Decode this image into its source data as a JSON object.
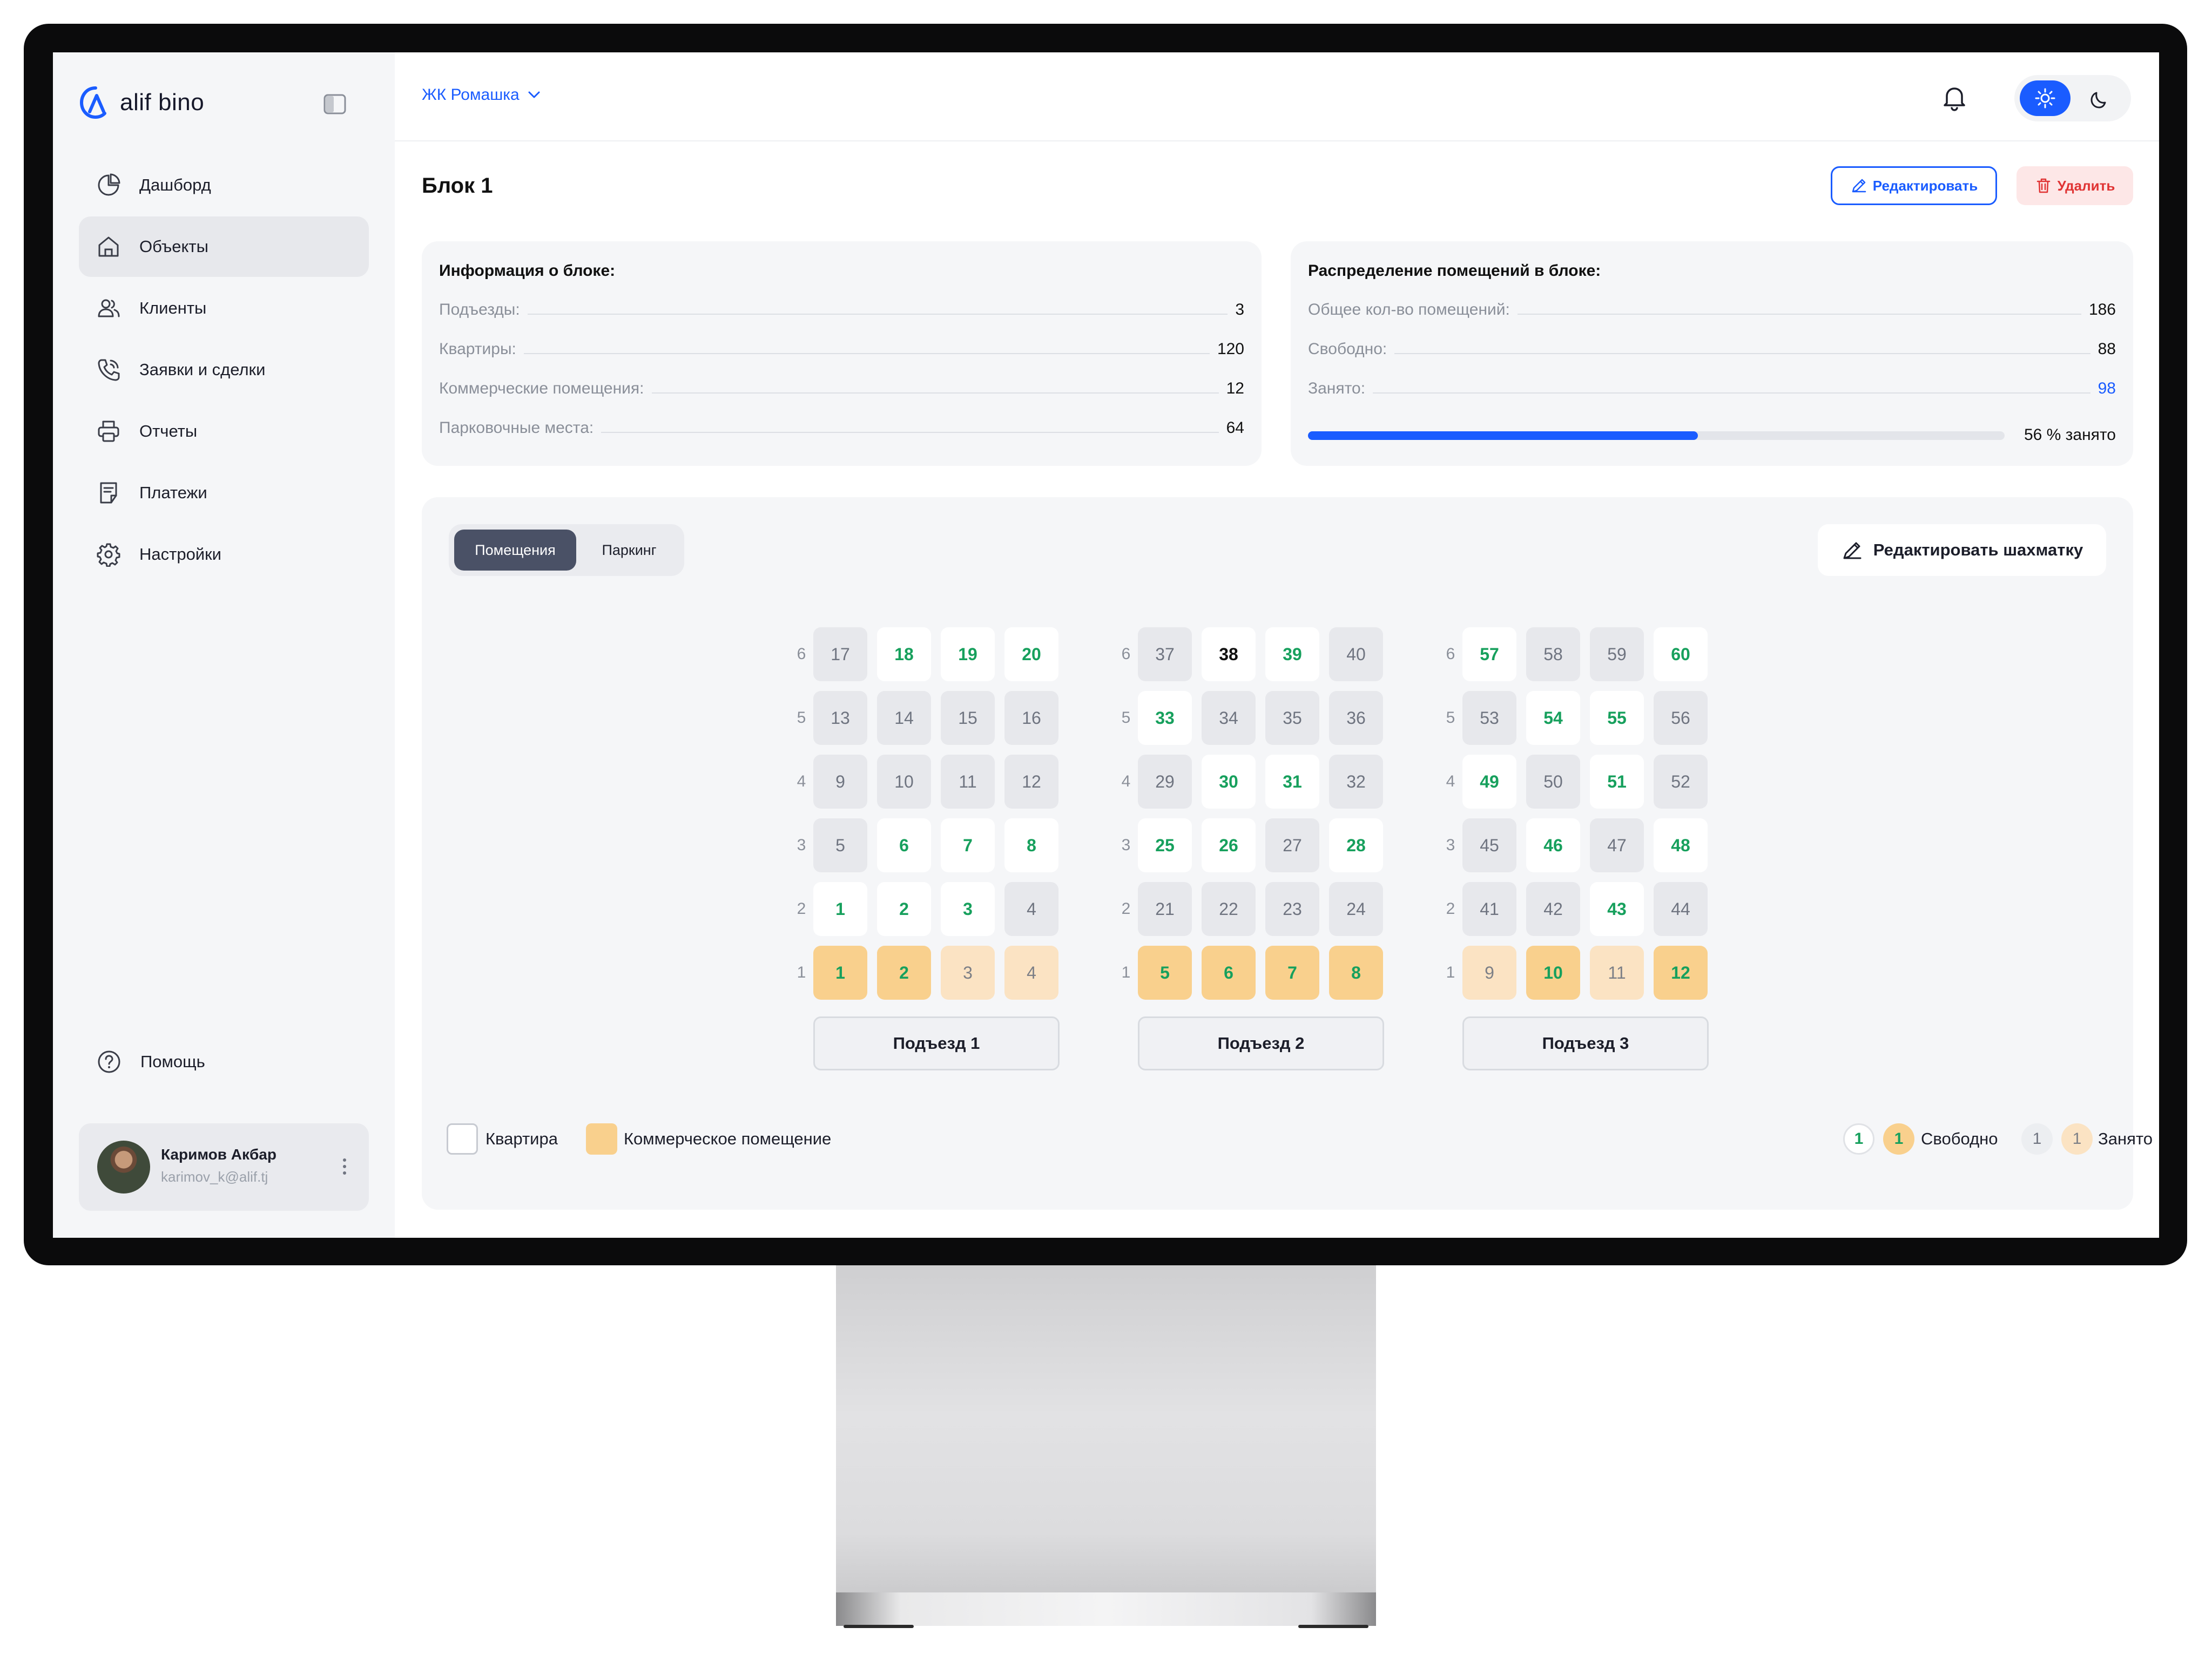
{
  "sidebar": {
    "logo": "alif bino",
    "items": [
      {
        "label": "Дашборд"
      },
      {
        "label": "Объекты"
      },
      {
        "label": "Клиенты"
      },
      {
        "label": "Заявки и сделки"
      },
      {
        "label": "Отчеты"
      },
      {
        "label": "Платежи"
      },
      {
        "label": "Настройки"
      }
    ],
    "help": "Помощь",
    "user": {
      "name": "Каримов Акбар",
      "email": "karimov_k@alif.tj"
    }
  },
  "header": {
    "complex": "ЖК Ромашка"
  },
  "page": {
    "title": "Блок 1",
    "edit": "Редактировать",
    "delete": "Удалить"
  },
  "info": {
    "title": "Информация о блоке:",
    "rows": [
      {
        "label": "Подъезды:",
        "value": "3"
      },
      {
        "label": "Квартиры:",
        "value": "120"
      },
      {
        "label": "Коммерческие помещения:",
        "value": "12"
      },
      {
        "label": "Парковочные места:",
        "value": "64"
      }
    ]
  },
  "distribution": {
    "title": "Распределение помещений в блоке:",
    "rows": [
      {
        "label": "Общее кол-во помещений:",
        "value": "186"
      },
      {
        "label": "Свободно:",
        "value": "88"
      },
      {
        "label": "Занято:",
        "value": "98"
      }
    ],
    "occupied_percent": 56,
    "progress_label": "56 % занято"
  },
  "chess": {
    "tabs": [
      "Помещения",
      "Паркинг"
    ],
    "edit_button": "Редактировать шахматку",
    "floors": [
      "6",
      "5",
      "4",
      "3",
      "2",
      "1"
    ],
    "entrances": [
      {
        "name": "Подъезд 1",
        "rows": [
          [
            {
              "n": "17",
              "s": "busy"
            },
            {
              "n": "18",
              "s": "free"
            },
            {
              "n": "19",
              "s": "free"
            },
            {
              "n": "20",
              "s": "free"
            }
          ],
          [
            {
              "n": "13",
              "s": "busy"
            },
            {
              "n": "14",
              "s": "busy"
            },
            {
              "n": "15",
              "s": "busy"
            },
            {
              "n": "16",
              "s": "busy"
            }
          ],
          [
            {
              "n": "9",
              "s": "busy"
            },
            {
              "n": "10",
              "s": "busy"
            },
            {
              "n": "11",
              "s": "busy"
            },
            {
              "n": "12",
              "s": "busy"
            }
          ],
          [
            {
              "n": "5",
              "s": "busy"
            },
            {
              "n": "6",
              "s": "free"
            },
            {
              "n": "7",
              "s": "free"
            },
            {
              "n": "8",
              "s": "free"
            }
          ],
          [
            {
              "n": "1",
              "s": "free"
            },
            {
              "n": "2",
              "s": "free"
            },
            {
              "n": "3",
              "s": "free"
            },
            {
              "n": "4",
              "s": "busy"
            }
          ],
          [
            {
              "n": "1",
              "s": "comfree"
            },
            {
              "n": "2",
              "s": "comfree"
            },
            {
              "n": "3",
              "s": "combusy"
            },
            {
              "n": "4",
              "s": "combusy"
            }
          ]
        ]
      },
      {
        "name": "Подъезд 2",
        "rows": [
          [
            {
              "n": "37",
              "s": "busy"
            },
            {
              "n": "38",
              "s": "white"
            },
            {
              "n": "39",
              "s": "free"
            },
            {
              "n": "40",
              "s": "busy"
            }
          ],
          [
            {
              "n": "33",
              "s": "free"
            },
            {
              "n": "34",
              "s": "busy"
            },
            {
              "n": "35",
              "s": "busy"
            },
            {
              "n": "36",
              "s": "busy"
            }
          ],
          [
            {
              "n": "29",
              "s": "busy"
            },
            {
              "n": "30",
              "s": "free"
            },
            {
              "n": "31",
              "s": "free"
            },
            {
              "n": "32",
              "s": "busy"
            }
          ],
          [
            {
              "n": "25",
              "s": "free"
            },
            {
              "n": "26",
              "s": "free"
            },
            {
              "n": "27",
              "s": "busy"
            },
            {
              "n": "28",
              "s": "free"
            }
          ],
          [
            {
              "n": "21",
              "s": "busy"
            },
            {
              "n": "22",
              "s": "busy"
            },
            {
              "n": "23",
              "s": "busy"
            },
            {
              "n": "24",
              "s": "busy"
            }
          ],
          [
            {
              "n": "5",
              "s": "comfree"
            },
            {
              "n": "6",
              "s": "comfree"
            },
            {
              "n": "7",
              "s": "comfree"
            },
            {
              "n": "8",
              "s": "comfree"
            }
          ]
        ]
      },
      {
        "name": "Подъезд 3",
        "rows": [
          [
            {
              "n": "57",
              "s": "free"
            },
            {
              "n": "58",
              "s": "busy"
            },
            {
              "n": "59",
              "s": "busy"
            },
            {
              "n": "60",
              "s": "free"
            }
          ],
          [
            {
              "n": "53",
              "s": "busy"
            },
            {
              "n": "54",
              "s": "free"
            },
            {
              "n": "55",
              "s": "free"
            },
            {
              "n": "56",
              "s": "busy"
            }
          ],
          [
            {
              "n": "49",
              "s": "free"
            },
            {
              "n": "50",
              "s": "busy"
            },
            {
              "n": "51",
              "s": "free"
            },
            {
              "n": "52",
              "s": "busy"
            }
          ],
          [
            {
              "n": "45",
              "s": "busy"
            },
            {
              "n": "46",
              "s": "free"
            },
            {
              "n": "47",
              "s": "busy"
            },
            {
              "n": "48",
              "s": "free"
            }
          ],
          [
            {
              "n": "41",
              "s": "busy"
            },
            {
              "n": "42",
              "s": "busy"
            },
            {
              "n": "43",
              "s": "free"
            },
            {
              "n": "44",
              "s": "busy"
            }
          ],
          [
            {
              "n": "9",
              "s": "combusy"
            },
            {
              "n": "10",
              "s": "comfree"
            },
            {
              "n": "11",
              "s": "combusy"
            },
            {
              "n": "12",
              "s": "comfree"
            }
          ]
        ]
      }
    ],
    "legend": {
      "apartment": "Квартира",
      "commercial": "Коммерческое помещение",
      "free": "Свободно",
      "occupied": "Занято",
      "sample": "1"
    }
  },
  "colors": {
    "accent": "#1a5cff",
    "free_text": "#17a05d",
    "commercial": "#f9d08d",
    "danger": "#e03434"
  }
}
